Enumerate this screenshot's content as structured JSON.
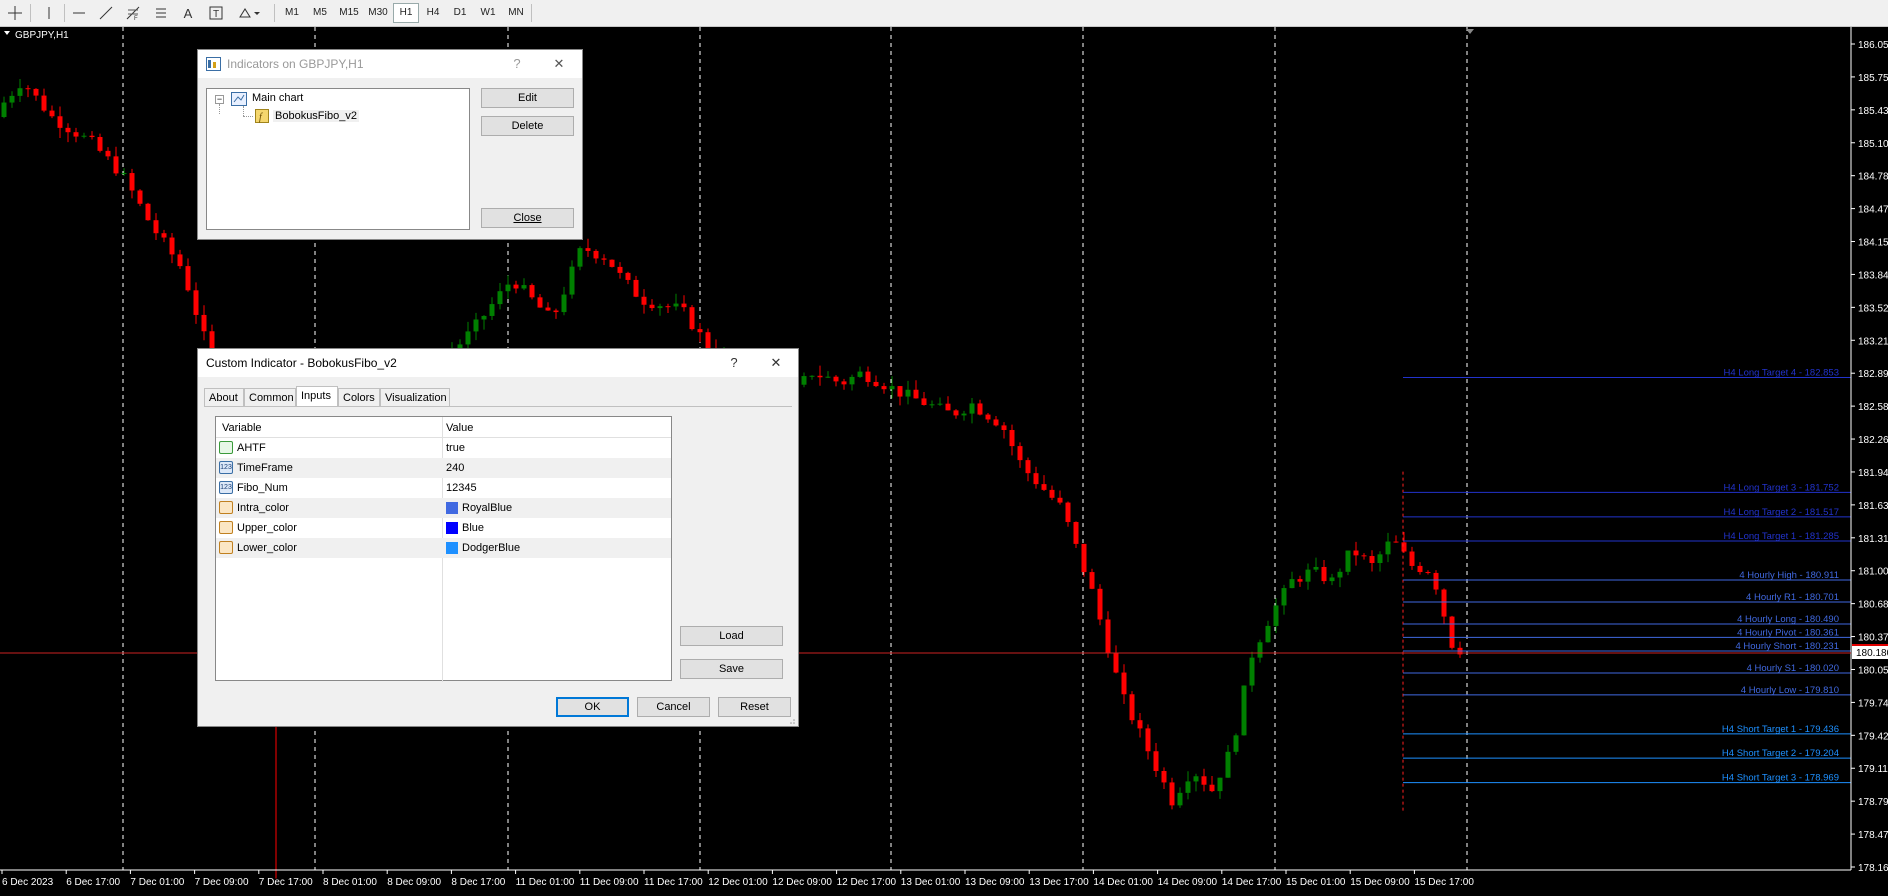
{
  "toolbar": {
    "timeframes": [
      "M1",
      "M5",
      "M15",
      "M30",
      "H1",
      "H4",
      "D1",
      "W1",
      "MN"
    ],
    "active_timeframe": "H1",
    "tools": [
      "crosshair-icon",
      "vertical-line-icon",
      "horizontal-line-icon",
      "trend-line-icon",
      "fibonacci-icon",
      "channel-icon",
      "text-icon",
      "text-label-icon",
      "shapes-menu-icon"
    ]
  },
  "chart": {
    "symbol_label": "GBPJPY,H1",
    "current_price": "180.180",
    "price_ticks": [
      "186.050",
      "185.750",
      "185.430",
      "185.100",
      "184.785",
      "184.470",
      "184.155",
      "183.840",
      "183.525",
      "183.210",
      "182.895",
      "182.580",
      "182.265",
      "181.945",
      "181.630",
      "181.315",
      "181.000",
      "180.685",
      "180.370",
      "180.055",
      "179.740",
      "179.425",
      "179.110",
      "178.795",
      "178.475",
      "178.160"
    ],
    "time_ticks": [
      "6 Dec 2023",
      "6 Dec 17:00",
      "7 Dec 01:00",
      "7 Dec 09:00",
      "7 Dec 17:00",
      "8 Dec 01:00",
      "8 Dec 09:00",
      "8 Dec 17:00",
      "11 Dec 01:00",
      "11 Dec 09:00",
      "11 Dec 17:00",
      "12 Dec 01:00",
      "12 Dec 09:00",
      "12 Dec 17:00",
      "13 Dec 01:00",
      "13 Dec 09:00",
      "13 Dec 17:00",
      "14 Dec 01:00",
      "14 Dec 09:00",
      "14 Dec 17:00",
      "15 Dec 01:00",
      "15 Dec 09:00",
      "15 Dec 17:00"
    ],
    "levels": [
      {
        "label": "H4 Long Target 4 - 182.853",
        "price": 182.853,
        "color": "#2233cc"
      },
      {
        "label": "H4 Long Target 3 - 181.752",
        "price": 181.752,
        "color": "#2233cc"
      },
      {
        "label": "H4 Long Target 2 - 181.517",
        "price": 181.517,
        "color": "#2233cc"
      },
      {
        "label": "H4 Long Target 1 - 181.285",
        "price": 181.285,
        "color": "#2233cc"
      },
      {
        "label": "4 Hourly High - 180.911",
        "price": 180.911,
        "color": "#4169e1"
      },
      {
        "label": "4 Hourly R1 - 180.701",
        "price": 180.701,
        "color": "#4169e1"
      },
      {
        "label": "4 Hourly Long - 180.490",
        "price": 180.49,
        "color": "#4169e1"
      },
      {
        "label": "4 Hourly Pivot - 180.361",
        "price": 180.361,
        "color": "#4169e1"
      },
      {
        "label": "4 Hourly Short - 180.231",
        "price": 180.231,
        "color": "#4169e1"
      },
      {
        "label": "4 Hourly S1 - 180.020",
        "price": 180.02,
        "color": "#4169e1"
      },
      {
        "label": "4 Hourly Low - 179.810",
        "price": 179.81,
        "color": "#4169e1"
      },
      {
        "label": "H4 Short Target 1 - 179.436",
        "price": 179.436,
        "color": "#1e90ff"
      },
      {
        "label": "H4 Short Target 2 - 179.204",
        "price": 179.204,
        "color": "#1e90ff"
      },
      {
        "label": "H4 Short Target 3 - 178.969",
        "price": 178.969,
        "color": "#1e90ff"
      }
    ]
  },
  "indicators_dialog": {
    "title": "Indicators on GBPJPY,H1",
    "help": "?",
    "tree_root": "Main chart",
    "tree_child": "BobokusFibo_v2",
    "edit": "Edit",
    "delete": "Delete",
    "close": "Close"
  },
  "custom_dialog": {
    "title": "Custom Indicator - BobokusFibo_v2",
    "help": "?",
    "tabs": [
      "About",
      "Common",
      "Inputs",
      "Colors",
      "Visualization"
    ],
    "active_tab": "Inputs",
    "col_variable": "Variable",
    "col_value": "Value",
    "rows": [
      {
        "variable": "AHTF",
        "value": "true",
        "icon": "bool-icon"
      },
      {
        "variable": "TimeFrame",
        "value": "240",
        "icon": "int-icon"
      },
      {
        "variable": "Fibo_Num",
        "value": "12345",
        "icon": "int-icon"
      },
      {
        "variable": "Intra_color",
        "value": "RoyalBlue",
        "icon": "color-icon",
        "swatch": "#4169e1"
      },
      {
        "variable": "Upper_color",
        "value": "Blue",
        "icon": "color-icon",
        "swatch": "#0000ff"
      },
      {
        "variable": "Lower_color",
        "value": "DodgerBlue",
        "icon": "color-icon",
        "swatch": "#1e90ff"
      }
    ],
    "load": "Load",
    "save": "Save",
    "ok": "OK",
    "cancel": "Cancel",
    "reset": "Reset"
  }
}
